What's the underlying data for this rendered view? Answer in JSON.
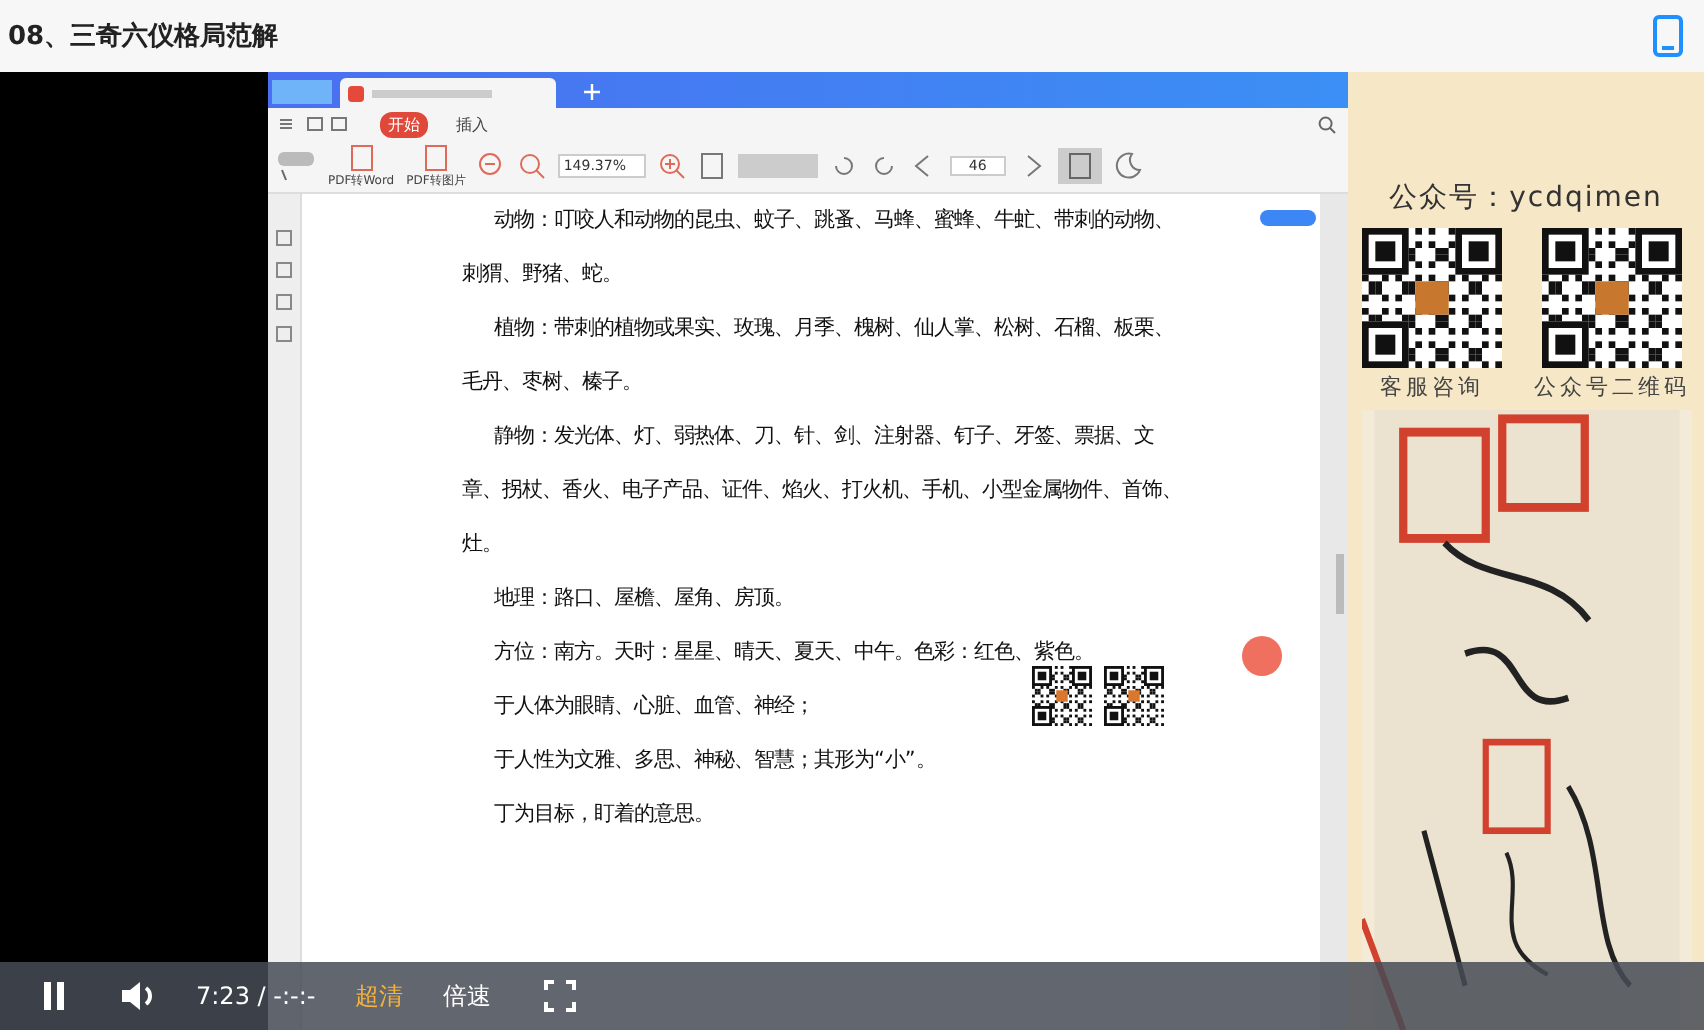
{
  "title": "08、三奇六仪格局范解",
  "pdf": {
    "menu": [
      {
        "label": "开始",
        "selected": true
      },
      {
        "label": "插入",
        "selected": false
      }
    ],
    "tools": [
      "PDF转Word",
      "PDF转图片"
    ],
    "zoom": "149.37%",
    "page": "46",
    "paragraphs": [
      "动物：叮咬人和动物的昆虫、蚊子、跳蚤、马蜂、蜜蜂、牛虻、带刺的动物、刺猬、野猪、蛇。",
      "植物：带刺的植物或果实、玫瑰、月季、槐树、仙人掌、松树、石榴、板栗、毛丹、枣树、榛子。",
      "静物：发光体、灯、弱热体、刀、针、剑、注射器、钉子、牙签、票据、文章、拐杖、香火、电子产品、证件、焰火、打火机、手机、小型金属物件、首饰、灶。",
      "地理：路口、屋檐、屋角、房顶。",
      "方位：南方。天时：星星、晴天、夏天、中午。色彩：红色、紫色。",
      "于人体为眼睛、心脏、血管、神经；",
      "于人性为文雅、多思、神秘、智慧；其形为“小”。",
      "丁为目标，盯着的意思。"
    ]
  },
  "side": {
    "account": "公众号：ycdqimen",
    "qr_labels": [
      "客服咨询",
      "公众号二维码"
    ]
  },
  "player": {
    "playing": true,
    "time": "7:23 / -:-:-",
    "quality": "超清",
    "speed": "倍速"
  }
}
